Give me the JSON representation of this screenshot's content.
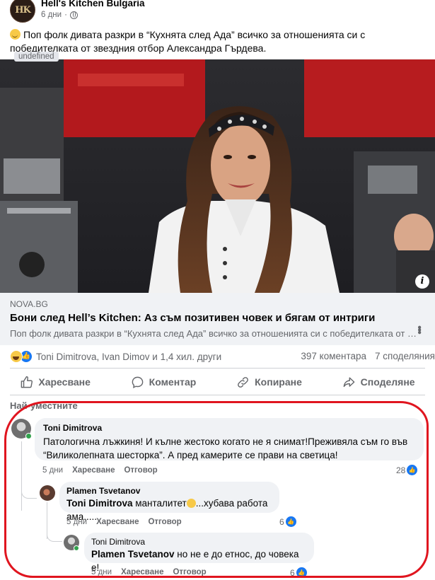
{
  "post": {
    "page_name": "Hell's Kitchen Bulgaria",
    "avatar_text": "HK",
    "time": "6 дни",
    "text": "Поп фолк дивата разкри в “Кухнята след Ада” всичко за отношенията си с победителката от звездния отбор Александра Гърдева.",
    "image_badge": "undefined"
  },
  "link": {
    "domain": "NOVA.BG",
    "title": "Бони след Hell’s Kitchen: Аз съм позитивен човек и бягам от интриги",
    "description": "Поп фолк дивата разкри в “Кухнята след Ада” всичко за отношенията си с победителката от звездния отбор Александра Гърдева."
  },
  "reactions": {
    "names": "Toni Dimitrova, Ivan Dimov и 1,4 хил. други",
    "comments": "397 коментара",
    "shares": "7 споделяния"
  },
  "actions": {
    "like": "Харесване",
    "comment": "Коментар",
    "copy": "Копиране",
    "share": "Споделяне"
  },
  "sort_label": "Най-уместните",
  "comments": [
    {
      "author": "Toni Dimitrova",
      "text": "Патологична лъжкиня! И кълне жестоко когато не я снимат!Преживяла съм го във “Виликолепната шесторка”. А пред камерите се прави на светица!",
      "time": "5 дни",
      "like": "Харесване",
      "reply": "Отговор",
      "likes": "28"
    },
    {
      "author": "Plamen Tsvetanov",
      "mention": "Toni Dimitrova",
      "text": " манталитет",
      "text_after": "...хубава работа ама.....",
      "time": "5 дни",
      "like": "Харесване",
      "reply": "Отговор",
      "likes": "6"
    },
    {
      "author": "Toni Dimitrova",
      "mention": "Plamen Tsvetanov",
      "text": " но не е до етнос, до човека е!",
      "time": "5 дни",
      "like": "Харесване",
      "reply": "Отговор",
      "likes": "6"
    }
  ],
  "colors": {
    "annotation_circle": "#e0151f",
    "brand_blue": "#1877f2"
  }
}
